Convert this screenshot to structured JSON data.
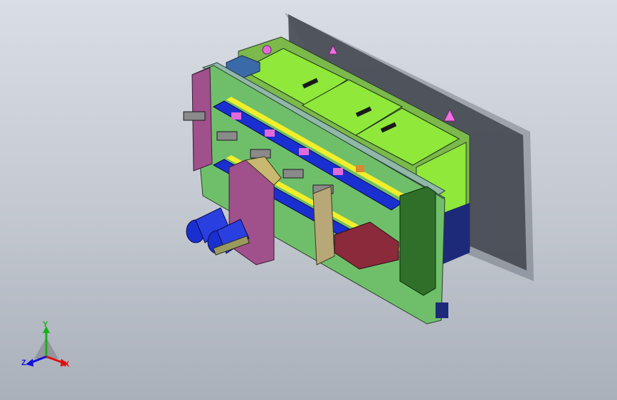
{
  "viewport": {
    "background_top": "#d9dde4",
    "background_bottom": "#aab0ba",
    "model": {
      "description_icon": "cad-assembly-icon",
      "colors": {
        "green_cover": "#8fe83a",
        "dark_green": "#2f6f2a",
        "plate_green": "#6fbf6a",
        "magenta": "#a0508a",
        "blue": "#1a2fd0",
        "yellow": "#f2ef2a",
        "pink": "#e06ad8",
        "rail": "#8fb8a8",
        "shadow": "#3c4048"
      }
    }
  },
  "triad": {
    "x_label": "X",
    "y_label": "Y",
    "z_label": "Z",
    "x_color": "#e01010",
    "y_color": "#18b018",
    "z_color": "#1010e0"
  }
}
